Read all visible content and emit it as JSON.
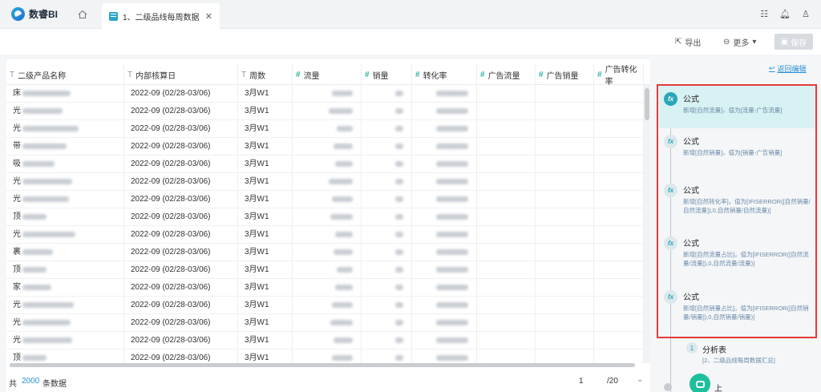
{
  "app": {
    "name": "数睿BI",
    "tab_title": "1、二级品线每周数据"
  },
  "toolbar": {
    "export_label": "导出",
    "more_label": "更多",
    "save_label": "保存"
  },
  "table": {
    "columns": [
      {
        "type": "T",
        "label": "二级产品名称",
        "numeric": false
      },
      {
        "type": "T",
        "label": "内部核算日",
        "numeric": false
      },
      {
        "type": "T",
        "label": "周数",
        "numeric": false
      },
      {
        "type": "#",
        "label": "流量",
        "numeric": true
      },
      {
        "type": "#",
        "label": "销量",
        "numeric": true
      },
      {
        "type": "#",
        "label": "转化率",
        "numeric": true
      },
      {
        "type": "#",
        "label": "广告流量",
        "numeric": true
      },
      {
        "type": "#",
        "label": "广告销量",
        "numeric": true
      },
      {
        "type": "#",
        "label": "广告转化率",
        "numeric": true
      }
    ],
    "rows": [
      {
        "name": "床",
        "date": "2022-09 (02/28-03/06)",
        "week": "3月W1"
      },
      {
        "name": "光",
        "date": "2022-09 (02/28-03/06)",
        "week": "3月W1"
      },
      {
        "name": "光",
        "date": "2022-09 (02/28-03/06)",
        "week": "3月W1"
      },
      {
        "name": "带",
        "date": "2022-09 (02/28-03/06)",
        "week": "3月W1"
      },
      {
        "name": "吸",
        "date": "2022-09 (02/28-03/06)",
        "week": "3月W1"
      },
      {
        "name": "光",
        "date": "2022-09 (02/28-03/06)",
        "week": "3月W1"
      },
      {
        "name": "光",
        "date": "2022-09 (02/28-03/06)",
        "week": "3月W1"
      },
      {
        "name": "顶",
        "date": "2022-09 (02/28-03/06)",
        "week": "3月W1"
      },
      {
        "name": "光",
        "date": "2022-09 (02/28-03/06)",
        "week": "3月W1"
      },
      {
        "name": "裹",
        "date": "2022-09 (02/28-03/06)",
        "week": "3月W1"
      },
      {
        "name": "顶",
        "date": "2022-09 (02/28-03/06)",
        "week": "3月W1"
      },
      {
        "name": "家",
        "date": "2022-09 (02/28-03/06)",
        "week": "3月W1"
      },
      {
        "name": "光",
        "date": "2022-09 (02/28-03/06)",
        "week": "3月W1"
      },
      {
        "name": "光",
        "date": "2022-09 (02/28-03/06)",
        "week": "3月W1"
      },
      {
        "name": "光",
        "date": "2022-09 (02/28-03/06)",
        "week": "3月W1"
      },
      {
        "name": "顶",
        "date": "2022-09 (02/28-03/06)",
        "week": "3月W1"
      }
    ]
  },
  "footer": {
    "total_prefix": "共",
    "total_count": "2000",
    "total_suffix": "条数据",
    "page": "1",
    "page_size": "/20"
  },
  "steps_panel": {
    "back_label": "返回编辑",
    "steps": [
      {
        "title": "公式",
        "desc": "新增[自然流量]，值为[流量-广告流量]",
        "active": true
      },
      {
        "title": "公式",
        "desc": "新增[自然销量]，值为[销量-广告销量]",
        "active": false
      },
      {
        "title": "公式",
        "desc": "新增[自然转化率]，值为[IFISERROR([自然销量/自然流量]),0,自然销量/自然流量)]",
        "active": false
      },
      {
        "title": "公式",
        "desc": "新增[自然流量占比]，值为[IFISERROR([自然流量/流量]),0,自然流量/流量)]",
        "active": false
      },
      {
        "title": "公式",
        "desc": "新增[自然销量占比]，值为[IFISERROR([自然销量/销量]),0,自然销量/销量)]",
        "active": false
      }
    ],
    "sub_step": {
      "num": "1",
      "title": "分析表",
      "desc": "[2、二级品线每周数据汇总]"
    },
    "bottom_label": "上"
  }
}
